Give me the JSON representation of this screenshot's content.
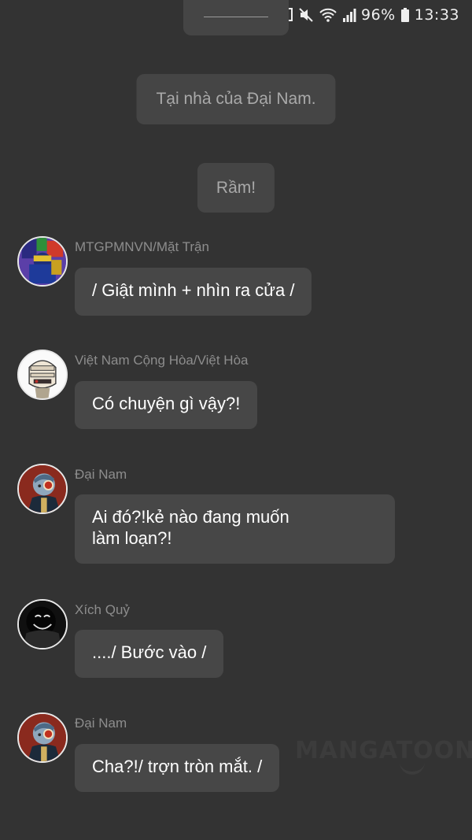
{
  "status_bar": {
    "battery": "96%",
    "time": "13:33",
    "icons": [
      "cast-icon",
      "mute-icon",
      "wifi-icon",
      "signal-icon",
      "battery-icon"
    ]
  },
  "narrations": [
    {
      "text": "Tại nhà của Đại Nam."
    },
    {
      "text": "Rầm!"
    }
  ],
  "messages": [
    {
      "name": "MTGPMNVN/Mặt Trận",
      "lines": [
        "/ Giật mình + nhìn ra cửa /"
      ]
    },
    {
      "name": "Việt Nam Cộng Hòa/Việt Hòa",
      "lines": [
        "Có chuyện gì vậy?!"
      ]
    },
    {
      "name": "Đại Nam",
      "lines": [
        "Ai đó?!kẻ nào đang muốn",
        "làm loạn?!"
      ]
    },
    {
      "name": "Xích Quỷ",
      "lines": [
        "..../ Bước vào /"
      ]
    },
    {
      "name": "Đại Nam",
      "lines": [
        "Cha?!/ trợn tròn mắt. /"
      ]
    }
  ],
  "watermark": "MANGATOON"
}
